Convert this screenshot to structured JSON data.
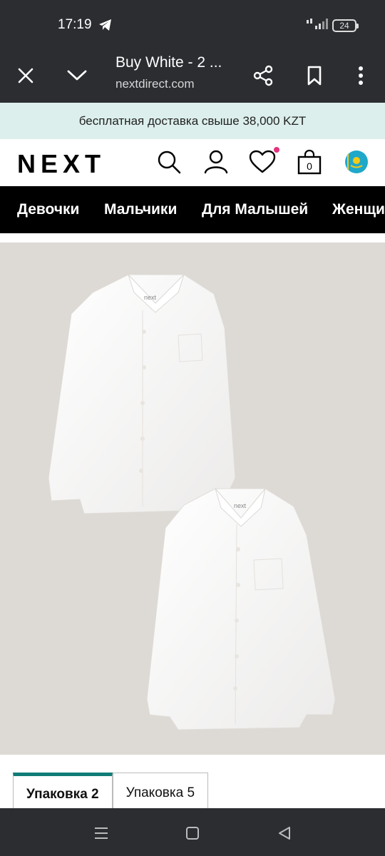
{
  "status_bar": {
    "time": "17:19",
    "network": "4G",
    "battery": "24"
  },
  "browser": {
    "title": "Buy White - 2 ...",
    "url": "nextdirect.com"
  },
  "promo": {
    "text": "бесплатная доставка свыше 38,000 KZT"
  },
  "header": {
    "logo": "NEXT",
    "bag_count": "0"
  },
  "nav": {
    "items": [
      {
        "label": "Девочки"
      },
      {
        "label": "Мальчики"
      },
      {
        "label": "Для Малышей"
      },
      {
        "label": "Женщи"
      }
    ]
  },
  "product": {
    "brand_tag_1": "next",
    "brand_tag_2": "next"
  },
  "pack_tabs": [
    {
      "label": "Упаковка 2",
      "selected": true
    },
    {
      "label": "Упаковка 5",
      "selected": false
    }
  ],
  "colors": {
    "accent": "#117c76",
    "promo_bg": "#dcefec",
    "wishlist_dot": "#e3337d"
  }
}
